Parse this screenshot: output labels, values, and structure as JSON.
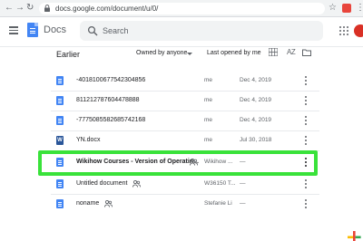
{
  "browser": {
    "back_icon": "back-arrow",
    "forward_icon": "forward-arrow",
    "reload_icon": "reload",
    "url": "docs.google.com/document/u/0/"
  },
  "header": {
    "app_title": "Docs",
    "search_placeholder": "Search",
    "avatar_color": "#d93025"
  },
  "list_controls": {
    "section_title": "Earlier",
    "owned_filter": "Owned by anyone",
    "sort_label": "Last opened by me",
    "sort_icon_text": "AZ"
  },
  "documents": [
    {
      "icon": "docs-icon",
      "title": "-4018100677542304856",
      "shared": false,
      "owner": "me",
      "date": "Dec 4, 2019"
    },
    {
      "icon": "docs-icon",
      "title": "8112127876044788​88",
      "shared": false,
      "owner": "me",
      "date": "Dec 4, 2019"
    },
    {
      "icon": "docs-icon",
      "title": "-7775085582685742168",
      "shared": false,
      "owner": "me",
      "date": "Dec 4, 2019"
    },
    {
      "icon": "word-icon",
      "title": "YN.docx",
      "shared": false,
      "owner": "me",
      "date": "Jul 30, 2018"
    },
    {
      "icon": "docs-icon",
      "title": "Wikihow Courses - Version of Operatin...",
      "shared": true,
      "owner": "Wikihow ...",
      "date": "—",
      "highlighted": true
    },
    {
      "icon": "docs-icon",
      "title": "Untitled document",
      "shared": true,
      "owner": "W36150 T...",
      "date": "—"
    },
    {
      "icon": "docs-icon",
      "title": "noname",
      "shared": true,
      "owner": "Stefanie Li",
      "date": "—"
    }
  ],
  "colors": {
    "docs_blue": "#4285f4",
    "word_blue": "#2a5699",
    "highlight_green": "#39e23a"
  },
  "word_icon_letter": "W"
}
